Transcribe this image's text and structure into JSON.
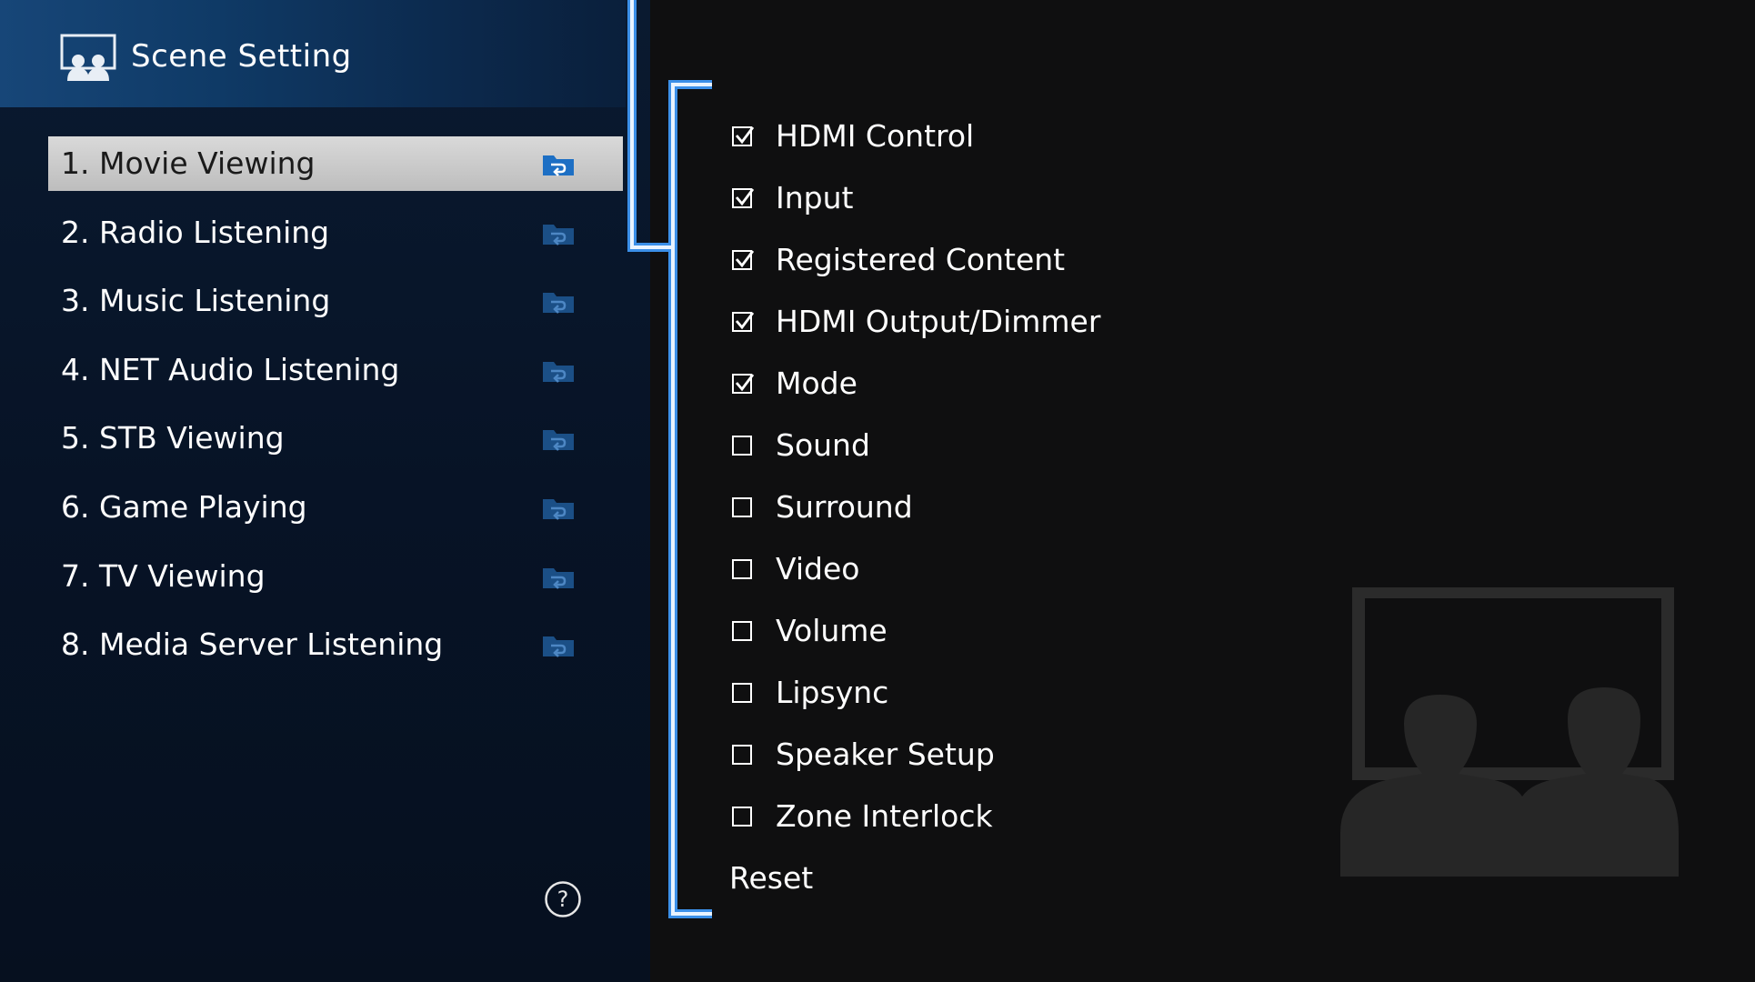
{
  "header": {
    "title": "Scene Setting",
    "icon": "scene-people-icon"
  },
  "scenes": [
    {
      "label": "1. Movie Viewing",
      "selected": true
    },
    {
      "label": "2. Radio Listening",
      "selected": false
    },
    {
      "label": "3. Music Listening",
      "selected": false
    },
    {
      "label": "4. NET Audio Listening",
      "selected": false
    },
    {
      "label": "5. STB Viewing",
      "selected": false
    },
    {
      "label": "6. Game Playing",
      "selected": false
    },
    {
      "label": "7. TV Viewing",
      "selected": false
    },
    {
      "label": "8. Media Server Listening",
      "selected": false
    }
  ],
  "options": [
    {
      "label": "HDMI Control",
      "checked": true
    },
    {
      "label": "Input",
      "checked": true
    },
    {
      "label": "Registered Content",
      "checked": true
    },
    {
      "label": "HDMI Output/Dimmer",
      "checked": true
    },
    {
      "label": "Mode",
      "checked": true
    },
    {
      "label": "Sound",
      "checked": false
    },
    {
      "label": "Surround",
      "checked": false
    },
    {
      "label": "Video",
      "checked": false
    },
    {
      "label": "Volume",
      "checked": false
    },
    {
      "label": "Lipsync",
      "checked": false
    },
    {
      "label": "Speaker Setup",
      "checked": false
    },
    {
      "label": "Zone Interlock",
      "checked": false
    }
  ],
  "reset_label": "Reset",
  "icons": {
    "scene_recall": "scene-recall-icon",
    "help": "help-icon",
    "illustration": "audience-silhouette-icon"
  },
  "colors": {
    "accent_blue": "#3b8fe8",
    "header_blue": "#174678",
    "panel_dark_blue": "#071326",
    "selected_bg": "#cfcfcf",
    "background": "#0f0f10"
  }
}
